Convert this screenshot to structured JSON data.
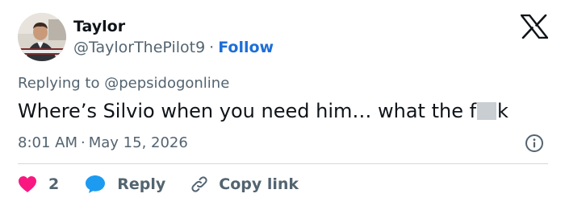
{
  "author": {
    "display_name": "Taylor",
    "handle": "@TaylorThePilot9",
    "separator": "·",
    "follow_label": "Follow"
  },
  "reply_context": {
    "prefix": "Replying to",
    "mention": "@pepsidogonline"
  },
  "tweet": {
    "text_before": "Where’s Silvio when you need him… what the f",
    "text_after": "k"
  },
  "meta": {
    "time": "8:01 AM",
    "separator": "·",
    "date": "May 15, 2026"
  },
  "actions": {
    "like_count": "2",
    "reply_label": "Reply",
    "copy_label": "Copy link"
  },
  "icons": {
    "brand": "x-logo-icon",
    "like": "heart-icon",
    "reply": "speech-bubble-icon",
    "copy": "link-icon",
    "info": "info-icon"
  },
  "colors": {
    "text_primary": "#0f1419",
    "text_secondary": "#536471",
    "link": "#1d6fd8",
    "like": "#f91880",
    "reply": "#1d9bf0",
    "divider": "#cfd9de"
  }
}
